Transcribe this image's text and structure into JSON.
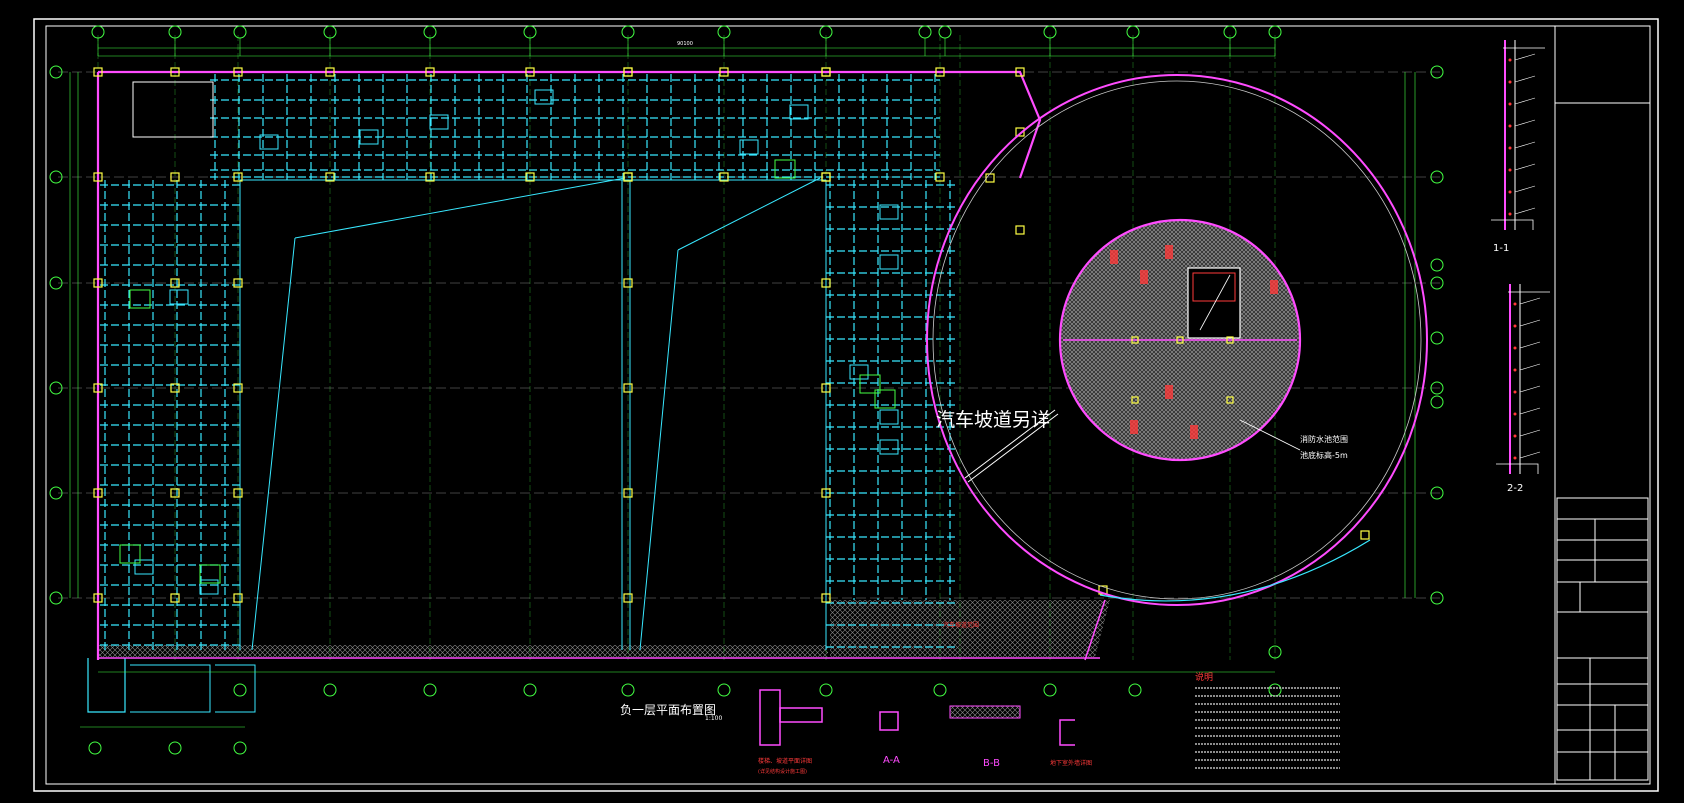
{
  "drawing": {
    "main_label": "汽车坡道另详",
    "plan_title": "负一层平面布置图",
    "scale": "1:100",
    "circle_note_line1": "消防水池范围",
    "circle_note_line2": "池底标高-5m",
    "notes_heading": "说明",
    "section_labels": {
      "s1": "1-1",
      "s2": "2-2",
      "aa": "A-A",
      "bb": "B-B"
    },
    "detail_labels": {
      "d1": "楼梯、坡道平面详图",
      "d1_sub": "(详见结构设计施工图)",
      "d2": "地下室外墙详图"
    },
    "hatch_label": "汽车坡道范围",
    "dimension_total": "90100"
  },
  "colors": {
    "background": "#000000",
    "frame": "#ffffff",
    "axis": "#43ff43",
    "structure": "#38e8ff",
    "wall": "#ff4cff",
    "column": "#ffff44",
    "accent": "#ff3a3a"
  }
}
